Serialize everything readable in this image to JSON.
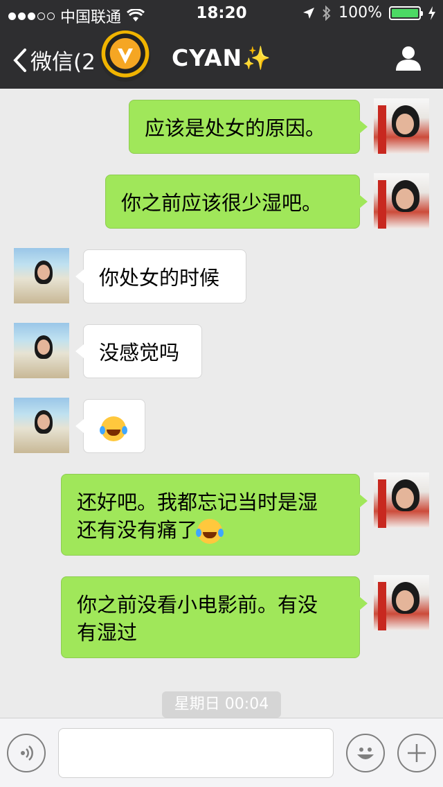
{
  "status_bar": {
    "carrier": "中国联通",
    "time": "18:20",
    "battery": "100%",
    "signal_dots_filled": 3,
    "signal_dots_total": 5
  },
  "nav": {
    "back_label": "微信(2",
    "title": "CYAN✨"
  },
  "messages": [
    {
      "from": "me",
      "text": "应该是处女的原因。"
    },
    {
      "from": "me",
      "text": "你之前应该很少湿吧。"
    },
    {
      "from": "other",
      "text": "你处女的时候"
    },
    {
      "from": "other",
      "text": "没感觉吗"
    },
    {
      "from": "other",
      "emoji": "laughing-tears"
    },
    {
      "from": "me",
      "line1": "还好吧。我都忘记当时是湿",
      "line2": "还有没有痛了",
      "emoji": "laughing-tears"
    },
    {
      "from": "me",
      "line1": "你之前没看小电影前。有没",
      "line2": "有湿过"
    }
  ],
  "timestamp": "星期日 00:04",
  "input_bar": {
    "voice_icon": "voice-icon",
    "emoji_icon": "emoji-icon",
    "plus_icon": "plus-icon",
    "value": ""
  },
  "colors": {
    "bar": "#2e2e30",
    "my_bubble": "#a0e75a",
    "other_bubble": "#ffffff",
    "background": "#ebebeb"
  }
}
